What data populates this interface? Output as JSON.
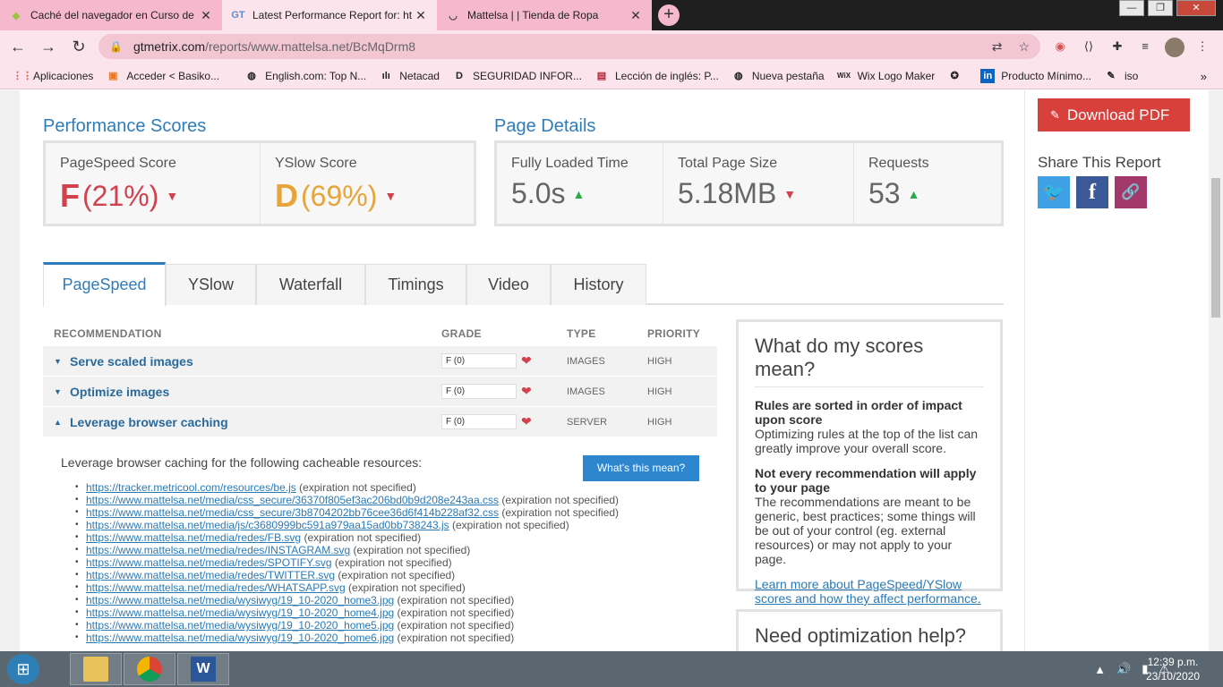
{
  "browser": {
    "tabs": [
      {
        "title": "Caché del navegador en Curso de",
        "favicon": "platzi-icon"
      },
      {
        "title": "Latest Performance Report for: ht",
        "favicon": "GT"
      },
      {
        "title": "Mattelsa | | Tienda de Ropa",
        "favicon": "mattelsa-icon"
      }
    ],
    "new_tab": "+",
    "url_host": "gtmetrix.com",
    "url_path": "/reports/www.mattelsa.net/BcMqDrm8",
    "bookmarks": [
      "Aplicaciones",
      "Acceder < Basiko...",
      "English.com: Top N...",
      "Netacad",
      "SEGURIDAD INFOR...",
      "Lección de inglés: P...",
      "Nueva pestaña",
      "Wix Logo Maker",
      "Producto Mínimo...",
      "iso"
    ],
    "bookmarks_more": "»"
  },
  "scores": {
    "title": "Performance Scores",
    "pagespeed": {
      "label": "PageSpeed Score",
      "grade": "F",
      "value": "(21%)"
    },
    "yslow": {
      "label": "YSlow Score",
      "grade": "D",
      "value": "(69%)"
    }
  },
  "details": {
    "title": "Page Details",
    "load_time": {
      "label": "Fully Loaded Time",
      "value": "5.0s"
    },
    "page_size": {
      "label": "Total Page Size",
      "value": "5.18MB"
    },
    "requests": {
      "label": "Requests",
      "value": "53"
    }
  },
  "tabs": [
    "PageSpeed",
    "YSlow",
    "Waterfall",
    "Timings",
    "Video",
    "History"
  ],
  "table": {
    "headers": {
      "recommendation": "RECOMMENDATION",
      "grade": "GRADE",
      "type": "TYPE",
      "priority": "PRIORITY"
    },
    "rows": [
      {
        "title": "Serve scaled images",
        "grade": "F (0)",
        "type": "IMAGES",
        "priority": "HIGH",
        "expanded": false
      },
      {
        "title": "Optimize images",
        "grade": "F (0)",
        "type": "IMAGES",
        "priority": "HIGH",
        "expanded": false
      },
      {
        "title": "Leverage browser caching",
        "grade": "F (0)",
        "type": "SERVER",
        "priority": "HIGH",
        "expanded": true
      }
    ]
  },
  "detail": {
    "intro": "Leverage browser caching for the following cacheable resources:",
    "button": "What's this mean?",
    "resources": [
      {
        "url": "https://tracker.metricool.com/resources/be.js",
        "note": " (expiration not specified)"
      },
      {
        "url": "https://www.mattelsa.net/media/css_secure/36370f805ef3ac206bd0b9d208e243aa.css",
        "note": " (expiration not specified)"
      },
      {
        "url": "https://www.mattelsa.net/media/css_secure/3b8704202bb76cee36d6f414b228af32.css",
        "note": " (expiration not specified)"
      },
      {
        "url": "https://www.mattelsa.net/media/js/c3680999bc591a979aa15ad0bb738243.js",
        "note": " (expiration not specified)"
      },
      {
        "url": "https://www.mattelsa.net/media/redes/FB.svg",
        "note": " (expiration not specified)"
      },
      {
        "url": "https://www.mattelsa.net/media/redes/INSTAGRAM.svg",
        "note": " (expiration not specified)"
      },
      {
        "url": "https://www.mattelsa.net/media/redes/SPOTIFY.svg",
        "note": " (expiration not specified)"
      },
      {
        "url": "https://www.mattelsa.net/media/redes/TWITTER.svg",
        "note": " (expiration not specified)"
      },
      {
        "url": "https://www.mattelsa.net/media/redes/WHATSAPP.svg",
        "note": " (expiration not specified)"
      },
      {
        "url": "https://www.mattelsa.net/media/wysiwyg/19_10-2020_home3.jpg",
        "note": " (expiration not specified)"
      },
      {
        "url": "https://www.mattelsa.net/media/wysiwyg/19_10-2020_home4.jpg",
        "note": " (expiration not specified)"
      },
      {
        "url": "https://www.mattelsa.net/media/wysiwyg/19_10-2020_home5.jpg",
        "note": " (expiration not specified)"
      },
      {
        "url": "https://www.mattelsa.net/media/wysiwyg/19_10-2020_home6.jpg",
        "note": " (expiration not specified)"
      }
    ]
  },
  "info": {
    "title": "What do my scores mean?",
    "p1_bold": "Rules are sorted in order of impact upon score",
    "p1_text": "Optimizing rules at the top of the list can greatly improve your overall score.",
    "p2_bold": "Not every recommendation will apply to your page",
    "p2_text": "The recommendations are meant to be generic, best practices; some things will be out of your control (eg. external resources) or may not apply to your page.",
    "link": "Learn more about PageSpeed/YSlow scores and how they affect performance."
  },
  "help": {
    "title": "Need optimization help?"
  },
  "sidebar": {
    "pdf": "Download PDF",
    "share_title": "Share This Report",
    "share_icons": [
      "twitter-icon",
      "facebook-icon",
      "link-icon"
    ]
  },
  "taskbar": {
    "time": "12:39 p.m.",
    "date": "23/10/2020"
  },
  "colors": {
    "accent": "#2e7dba",
    "grade_f": "#d1424e",
    "grade_d": "#e6a43a",
    "pdf": "#d8403c"
  }
}
